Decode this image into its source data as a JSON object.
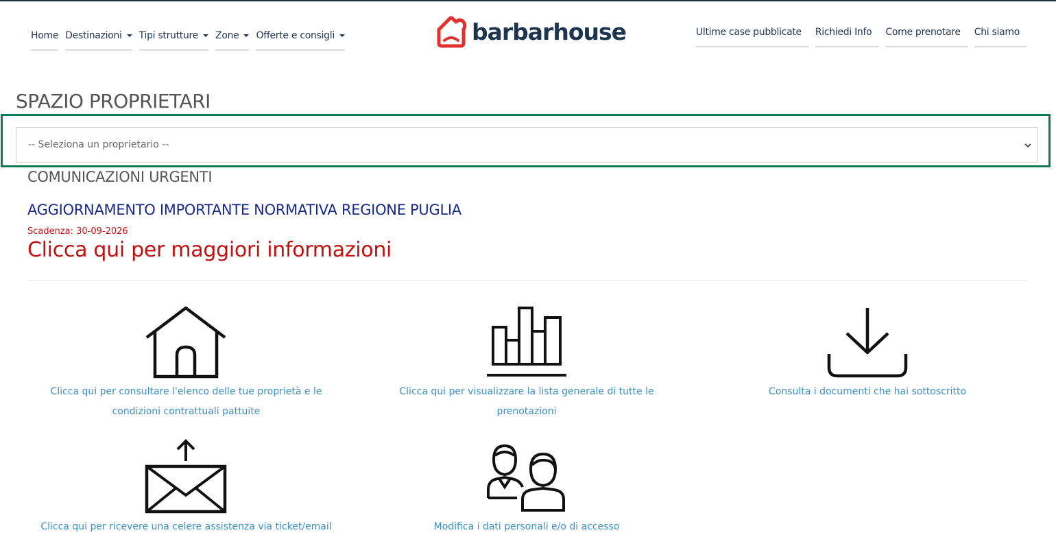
{
  "nav": {
    "left": [
      {
        "label": "Home",
        "dropdown": false
      },
      {
        "label": "Destinazioni",
        "dropdown": true
      },
      {
        "label": "Tipi strutture",
        "dropdown": true
      },
      {
        "label": "Zone",
        "dropdown": true
      },
      {
        "label": "Offerte e consigli",
        "dropdown": true
      }
    ],
    "right": [
      {
        "label": "Ultime case pubblicate"
      },
      {
        "label": "Richiedi Info"
      },
      {
        "label": "Come prenotare"
      },
      {
        "label": "Chi siamo"
      }
    ]
  },
  "logo": {
    "text": "barbarhouse",
    "icon": "house-heart-logo-icon"
  },
  "page": {
    "title": "SPAZIO PROPRIETARI",
    "select": {
      "selected": "-- Seleziona un proprietario --"
    },
    "urgent_title": "COMUNICAZIONI URGENTI",
    "news": {
      "title": "AGGIORNAMENTO IMPORTANTE NORMATIVA REGIONE PUGLIA",
      "deadline": "Scadenza: 30-09-2026",
      "link": "Clicca qui per maggiori informazioni"
    }
  },
  "tiles": [
    {
      "icon": "house-icon",
      "text": "Clicca qui per consultare l'elenco delle tue proprietà e le condizioni contrattuali pattuite"
    },
    {
      "icon": "bar-chart-icon",
      "text": "Clicca qui per visualizzare la lista generale di tutte le prenotazioni"
    },
    {
      "icon": "download-icon",
      "text": "Consulta i documenti che hai sottoscritto"
    },
    {
      "icon": "send-mail-icon",
      "text": "Clicca qui per ricevere una celere assistenza via ticket/email"
    },
    {
      "icon": "users-icon",
      "text": "Modifica i dati personali e/o di accesso"
    }
  ],
  "colors": {
    "nav_text": "#1f3550",
    "logo_red": "#e03030",
    "logo_dark": "#1e3550",
    "news_blue": "#1a2a8a",
    "alert_red": "#c01010",
    "link_blue": "#3a8fc2",
    "focus_green": "#0f7a4f"
  }
}
